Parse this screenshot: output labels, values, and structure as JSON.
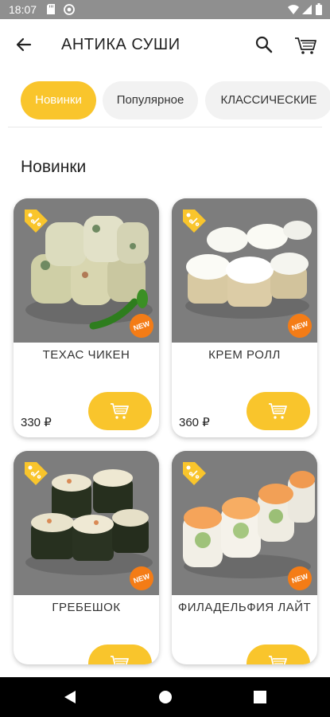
{
  "status_bar": {
    "time": "18:07"
  },
  "app_bar": {
    "title": "АНТИКА СУШИ"
  },
  "categories": [
    {
      "label": "Новинки",
      "active": true
    },
    {
      "label": "Популярное",
      "active": false
    },
    {
      "label": "КЛАССИЧЕСКИЕ",
      "active": false
    }
  ],
  "section": {
    "title": "Новинки"
  },
  "products": [
    {
      "name": "ТЕХАС ЧИКЕН",
      "price": "330 ₽",
      "badge": "NEW"
    },
    {
      "name": "КРЕМ РОЛЛ",
      "price": "360 ₽",
      "badge": "NEW"
    },
    {
      "name": "ГРЕБЕШОК",
      "price": "",
      "badge": "NEW"
    },
    {
      "name": "ФИЛАДЕЛЬФИЯ ЛАЙТ",
      "price": "",
      "badge": "NEW"
    }
  ],
  "colors": {
    "accent": "#f9c52c",
    "badge": "#f47c16",
    "status_bar": "#8f8f8f"
  }
}
